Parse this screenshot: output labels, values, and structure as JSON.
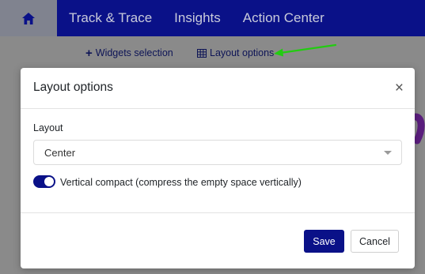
{
  "topnav": {
    "home_icon": "home-icon",
    "items": [
      {
        "label": "Track & Trace"
      },
      {
        "label": "Insights"
      },
      {
        "label": "Action Center"
      }
    ]
  },
  "toolbar": {
    "widgets_label": "Widgets selection",
    "widgets_icon": "plus-icon",
    "layout_label": "Layout options",
    "layout_icon": "grid-icon",
    "annotation_arrow_color": "#22cc11"
  },
  "modal": {
    "title": "Layout options",
    "close_icon": "close-icon",
    "layout_field": {
      "label": "Layout",
      "value": "Center"
    },
    "vertical_compact": {
      "checked": true,
      "label": "Vertical compact (compress the empty space vertically)"
    },
    "save_label": "Save",
    "cancel_label": "Cancel"
  },
  "colors": {
    "brand": "#0a1188",
    "nav_text": "#c8cada",
    "active_tab": "#80838f",
    "overlay": "#8a8a8a"
  }
}
